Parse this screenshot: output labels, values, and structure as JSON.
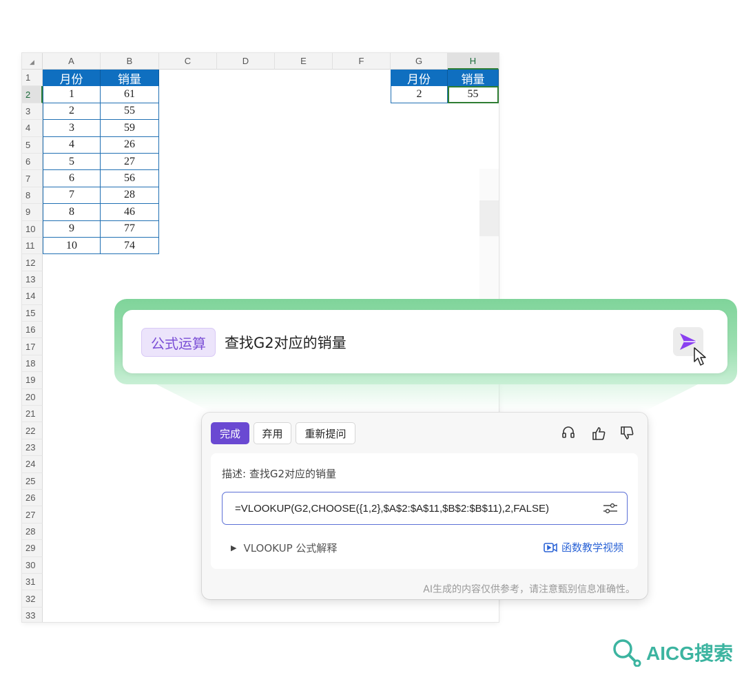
{
  "sheet": {
    "columns": [
      "A",
      "B",
      "C",
      "D",
      "E",
      "F",
      "G",
      "H"
    ],
    "rows": [
      "1",
      "2",
      "3",
      "4",
      "5",
      "6",
      "7",
      "8",
      "9",
      "10",
      "11",
      "12",
      "13",
      "14",
      "15",
      "16",
      "17",
      "18",
      "19",
      "20",
      "21",
      "22",
      "23",
      "24",
      "25",
      "26",
      "27",
      "28",
      "29",
      "30",
      "31",
      "32",
      "33"
    ],
    "table_headers": [
      "月份",
      "销量"
    ],
    "table_rows": [
      [
        "1",
        "61"
      ],
      [
        "2",
        "55"
      ],
      [
        "3",
        "59"
      ],
      [
        "4",
        "26"
      ],
      [
        "5",
        "27"
      ],
      [
        "6",
        "56"
      ],
      [
        "7",
        "28"
      ],
      [
        "8",
        "46"
      ],
      [
        "9",
        "77"
      ],
      [
        "10",
        "74"
      ]
    ],
    "lookup_headers": [
      "月份",
      "销量"
    ],
    "lookup_row": [
      "2",
      "55"
    ],
    "active_cell": "H2"
  },
  "prompt": {
    "tag": "公式运算",
    "query": "查找G2对应的销量"
  },
  "result": {
    "done_label": "完成",
    "discard_label": "弃用",
    "reask_label": "重新提问",
    "description": "描述: 查找G2对应的销量",
    "formula": "=VLOOKUP(G2,CHOOSE({1,2},$A$2:$A$11,$B$2:$B$11),2,FALSE)",
    "explain_label": "VLOOKUP 公式解释",
    "video_label": "函数教学视频",
    "disclaimer": "AI生成的内容仅供参考，请注意甄别信息准确性。"
  },
  "watermark": "AICG搜索",
  "colors": {
    "header_blue": "#0f6fc0",
    "accent_purple": "#6a49d2",
    "glow_green": "#7fd49a",
    "link_blue": "#2c64d6"
  }
}
